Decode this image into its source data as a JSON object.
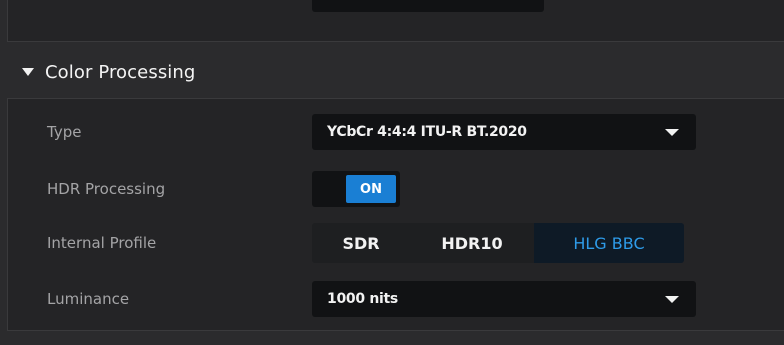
{
  "section": {
    "title": "Color Processing"
  },
  "rows": {
    "type": {
      "label": "Type",
      "value": "YCbCr 4:4:4 ITU-R BT.2020"
    },
    "hdr_processing": {
      "label": "HDR Processing",
      "state": "ON"
    },
    "internal_profile": {
      "label": "Internal Profile",
      "options": [
        "SDR",
        "HDR10",
        "HLG BBC"
      ],
      "selected": "HLG BBC"
    },
    "luminance": {
      "label": "Luminance",
      "value": "1000 nits"
    }
  },
  "colors": {
    "accent": "#1a7fd4",
    "selected_text": "#2e9be8",
    "panel": "#242426",
    "control_bg": "#111214"
  },
  "icons": {
    "section_toggle": "triangle-down-icon",
    "dropdown": "triangle-down-icon"
  }
}
